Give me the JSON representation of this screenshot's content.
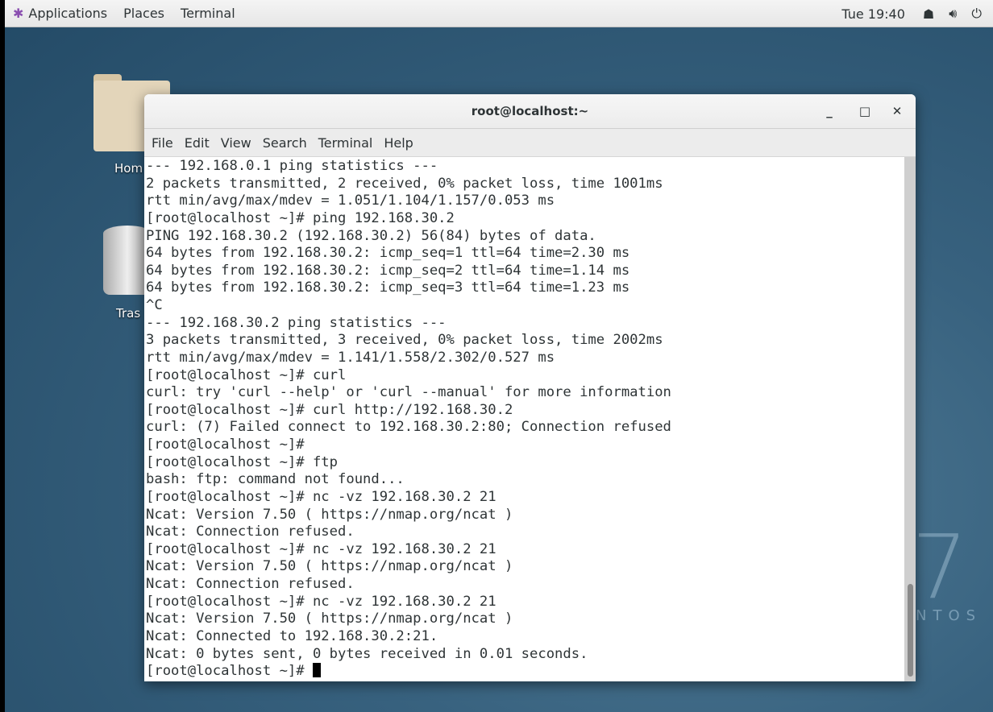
{
  "topbar": {
    "menus": [
      "Applications",
      "Places",
      "Terminal"
    ],
    "clock": "Tue 19:40",
    "icons": [
      "network-icon",
      "volume-icon",
      "power-icon"
    ]
  },
  "desktop": {
    "icons": [
      {
        "label": "Hom"
      },
      {
        "label": "Tras"
      }
    ],
    "logo_number": "7",
    "logo_text": "NTOS"
  },
  "window": {
    "title": "root@localhost:~",
    "menus": [
      "File",
      "Edit",
      "View",
      "Search",
      "Terminal",
      "Help"
    ],
    "lines": [
      "--- 192.168.0.1 ping statistics ---",
      "2 packets transmitted, 2 received, 0% packet loss, time 1001ms",
      "rtt min/avg/max/mdev = 1.051/1.104/1.157/0.053 ms",
      "[root@localhost ~]# ping 192.168.30.2",
      "PING 192.168.30.2 (192.168.30.2) 56(84) bytes of data.",
      "64 bytes from 192.168.30.2: icmp_seq=1 ttl=64 time=2.30 ms",
      "64 bytes from 192.168.30.2: icmp_seq=2 ttl=64 time=1.14 ms",
      "64 bytes from 192.168.30.2: icmp_seq=3 ttl=64 time=1.23 ms",
      "^C",
      "--- 192.168.30.2 ping statistics ---",
      "3 packets transmitted, 3 received, 0% packet loss, time 2002ms",
      "rtt min/avg/max/mdev = 1.141/1.558/2.302/0.527 ms",
      "[root@localhost ~]# curl",
      "curl: try 'curl --help' or 'curl --manual' for more information",
      "[root@localhost ~]# curl http://192.168.30.2",
      "curl: (7) Failed connect to 192.168.30.2:80; Connection refused",
      "[root@localhost ~]#",
      "[root@localhost ~]# ftp",
      "bash: ftp: command not found...",
      "[root@localhost ~]# nc -vz 192.168.30.2 21",
      "Ncat: Version 7.50 ( https://nmap.org/ncat )",
      "Ncat: Connection refused.",
      "[root@localhost ~]# nc -vz 192.168.30.2 21",
      "Ncat: Version 7.50 ( https://nmap.org/ncat )",
      "Ncat: Connection refused.",
      "[root@localhost ~]# nc -vz 192.168.30.2 21",
      "Ncat: Version 7.50 ( https://nmap.org/ncat )",
      "Ncat: Connected to 192.168.30.2:21.",
      "Ncat: 0 bytes sent, 0 bytes received in 0.01 seconds."
    ],
    "prompt": "[root@localhost ~]# "
  }
}
